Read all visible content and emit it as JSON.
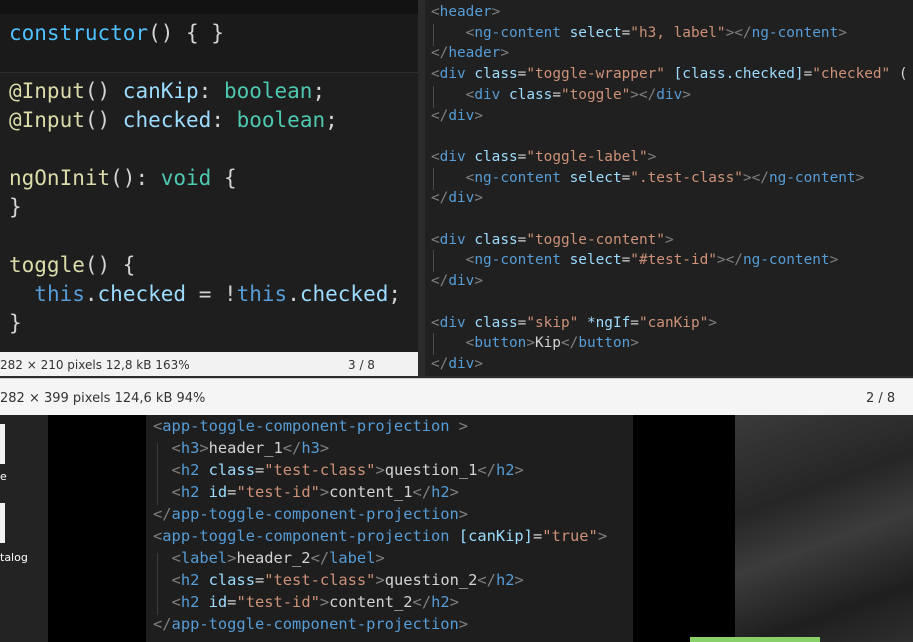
{
  "left_viewer": {
    "code_lines": [
      {
        "parts": [
          {
            "t": "constructor",
            "c": "kw-blue"
          },
          {
            "t": "() { }",
            "c": "plain"
          }
        ]
      },
      {
        "parts": []
      },
      {
        "parts": [
          {
            "t": "@Input",
            "c": "dec"
          },
          {
            "t": "() ",
            "c": "plain"
          },
          {
            "t": "canKip",
            "c": "attr"
          },
          {
            "t": ": ",
            "c": "plain"
          },
          {
            "t": "boolean",
            "c": "type"
          },
          {
            "t": ";",
            "c": "plain"
          }
        ]
      },
      {
        "parts": [
          {
            "t": "@Input",
            "c": "dec"
          },
          {
            "t": "() ",
            "c": "plain"
          },
          {
            "t": "checked",
            "c": "attr"
          },
          {
            "t": ": ",
            "c": "plain"
          },
          {
            "t": "boolean",
            "c": "type"
          },
          {
            "t": ";",
            "c": "plain"
          }
        ]
      },
      {
        "parts": []
      },
      {
        "parts": [
          {
            "t": "ngOnInit",
            "c": "fn"
          },
          {
            "t": "(): ",
            "c": "plain"
          },
          {
            "t": "void",
            "c": "type"
          },
          {
            "t": " {",
            "c": "plain"
          }
        ]
      },
      {
        "parts": [
          {
            "t": "}",
            "c": "plain"
          }
        ]
      },
      {
        "parts": []
      },
      {
        "parts": [
          {
            "t": "toggle",
            "c": "fn"
          },
          {
            "t": "() {",
            "c": "plain"
          }
        ]
      },
      {
        "parts": [
          {
            "t": "  ",
            "c": "plain"
          },
          {
            "t": "this",
            "c": "ctrl"
          },
          {
            "t": ".",
            "c": "plain"
          },
          {
            "t": "checked",
            "c": "attr"
          },
          {
            "t": " = !",
            "c": "plain"
          },
          {
            "t": "this",
            "c": "ctrl"
          },
          {
            "t": ".",
            "c": "plain"
          },
          {
            "t": "checked",
            "c": "attr"
          },
          {
            "t": ";",
            "c": "plain"
          }
        ]
      },
      {
        "parts": [
          {
            "t": "}",
            "c": "plain"
          }
        ]
      }
    ],
    "status_info": "282 × 210 pixels  12,8 kB   163%",
    "page_indicator": "3 / 8"
  },
  "right_viewer": {
    "code_lines": [
      {
        "parts": [
          {
            "t": "<",
            "c": "punc"
          },
          {
            "t": "header",
            "c": "tag"
          },
          {
            "t": ">",
            "c": "punc"
          }
        ]
      },
      {
        "parts": [
          {
            "t": "    <",
            "c": "punc"
          },
          {
            "t": "ng-content",
            "c": "tag"
          },
          {
            "t": " select",
            "c": "attr"
          },
          {
            "t": "=",
            "c": "plain"
          },
          {
            "t": "\"h3, label\"",
            "c": "str"
          },
          {
            "t": "></",
            "c": "punc"
          },
          {
            "t": "ng-content",
            "c": "tag"
          },
          {
            "t": ">",
            "c": "punc"
          }
        ]
      },
      {
        "parts": [
          {
            "t": "</",
            "c": "punc"
          },
          {
            "t": "header",
            "c": "tag"
          },
          {
            "t": ">",
            "c": "punc"
          }
        ]
      },
      {
        "parts": [
          {
            "t": "<",
            "c": "punc"
          },
          {
            "t": "div",
            "c": "tag"
          },
          {
            "t": " class",
            "c": "attr"
          },
          {
            "t": "=",
            "c": "plain"
          },
          {
            "t": "\"toggle-wrapper\"",
            "c": "str"
          },
          {
            "t": " [class.checked]",
            "c": "attr"
          },
          {
            "t": "=",
            "c": "plain"
          },
          {
            "t": "\"checked\"",
            "c": "str"
          },
          {
            "t": " (",
            "c": "plain"
          }
        ]
      },
      {
        "parts": [
          {
            "t": "    <",
            "c": "punc"
          },
          {
            "t": "div",
            "c": "tag"
          },
          {
            "t": " class",
            "c": "attr"
          },
          {
            "t": "=",
            "c": "plain"
          },
          {
            "t": "\"toggle\"",
            "c": "str"
          },
          {
            "t": "></",
            "c": "punc"
          },
          {
            "t": "div",
            "c": "tag"
          },
          {
            "t": ">",
            "c": "punc"
          }
        ]
      },
      {
        "parts": [
          {
            "t": "</",
            "c": "punc"
          },
          {
            "t": "div",
            "c": "tag"
          },
          {
            "t": ">",
            "c": "punc"
          }
        ]
      },
      {
        "parts": []
      },
      {
        "parts": [
          {
            "t": "<",
            "c": "punc"
          },
          {
            "t": "div",
            "c": "tag"
          },
          {
            "t": " class",
            "c": "attr"
          },
          {
            "t": "=",
            "c": "plain"
          },
          {
            "t": "\"toggle-label\"",
            "c": "str"
          },
          {
            "t": ">",
            "c": "punc"
          }
        ]
      },
      {
        "parts": [
          {
            "t": "    <",
            "c": "punc"
          },
          {
            "t": "ng-content",
            "c": "tag"
          },
          {
            "t": " select",
            "c": "attr"
          },
          {
            "t": "=",
            "c": "plain"
          },
          {
            "t": "\".test-class\"",
            "c": "str"
          },
          {
            "t": "></",
            "c": "punc"
          },
          {
            "t": "ng-content",
            "c": "tag"
          },
          {
            "t": ">",
            "c": "punc"
          }
        ]
      },
      {
        "parts": [
          {
            "t": "</",
            "c": "punc"
          },
          {
            "t": "div",
            "c": "tag"
          },
          {
            "t": ">",
            "c": "punc"
          }
        ]
      },
      {
        "parts": []
      },
      {
        "parts": [
          {
            "t": "<",
            "c": "punc"
          },
          {
            "t": "div",
            "c": "tag"
          },
          {
            "t": " class",
            "c": "attr"
          },
          {
            "t": "=",
            "c": "plain"
          },
          {
            "t": "\"toggle-content\"",
            "c": "str"
          },
          {
            "t": ">",
            "c": "punc"
          }
        ]
      },
      {
        "parts": [
          {
            "t": "    <",
            "c": "punc"
          },
          {
            "t": "ng-content",
            "c": "tag"
          },
          {
            "t": " select",
            "c": "attr"
          },
          {
            "t": "=",
            "c": "plain"
          },
          {
            "t": "\"#test-id\"",
            "c": "str"
          },
          {
            "t": "></",
            "c": "punc"
          },
          {
            "t": "ng-content",
            "c": "tag"
          },
          {
            "t": ">",
            "c": "punc"
          }
        ]
      },
      {
        "parts": [
          {
            "t": "</",
            "c": "punc"
          },
          {
            "t": "div",
            "c": "tag"
          },
          {
            "t": ">",
            "c": "punc"
          }
        ]
      },
      {
        "parts": []
      },
      {
        "parts": [
          {
            "t": "<",
            "c": "punc"
          },
          {
            "t": "div",
            "c": "tag"
          },
          {
            "t": " class",
            "c": "attr"
          },
          {
            "t": "=",
            "c": "plain"
          },
          {
            "t": "\"skip\"",
            "c": "str"
          },
          {
            "t": " *ngIf",
            "c": "attr"
          },
          {
            "t": "=",
            "c": "plain"
          },
          {
            "t": "\"canKip\"",
            "c": "str"
          },
          {
            "t": ">",
            "c": "punc"
          }
        ]
      },
      {
        "parts": [
          {
            "t": "    <",
            "c": "punc"
          },
          {
            "t": "button",
            "c": "tag"
          },
          {
            "t": ">",
            "c": "punc"
          },
          {
            "t": "Kip",
            "c": "plain"
          },
          {
            "t": "</",
            "c": "punc"
          },
          {
            "t": "button",
            "c": "tag"
          },
          {
            "t": ">",
            "c": "punc"
          }
        ]
      },
      {
        "parts": [
          {
            "t": "</",
            "c": "punc"
          },
          {
            "t": "div",
            "c": "tag"
          },
          {
            "t": ">",
            "c": "punc"
          }
        ]
      }
    ]
  },
  "bottom_viewer": {
    "status_info": "282 × 399 pixels  124,6 kB   94%",
    "page_indicator": "2 / 8",
    "desktop_labels": [
      "e",
      "talog"
    ],
    "code_lines": [
      {
        "parts": [
          {
            "t": "<",
            "c": "punc"
          },
          {
            "t": "app-toggle-component-projection",
            "c": "tag"
          },
          {
            "t": " >",
            "c": "punc"
          }
        ]
      },
      {
        "parts": [
          {
            "t": "  <",
            "c": "punc"
          },
          {
            "t": "h3",
            "c": "tag"
          },
          {
            "t": ">",
            "c": "punc"
          },
          {
            "t": "header_1",
            "c": "plain"
          },
          {
            "t": "</",
            "c": "punc"
          },
          {
            "t": "h3",
            "c": "tag"
          },
          {
            "t": ">",
            "c": "punc"
          }
        ]
      },
      {
        "parts": [
          {
            "t": "  <",
            "c": "punc"
          },
          {
            "t": "h2",
            "c": "tag"
          },
          {
            "t": " class",
            "c": "attr"
          },
          {
            "t": "=",
            "c": "plain"
          },
          {
            "t": "\"test-class\"",
            "c": "str"
          },
          {
            "t": ">",
            "c": "punc"
          },
          {
            "t": "question_1",
            "c": "plain"
          },
          {
            "t": "</",
            "c": "punc"
          },
          {
            "t": "h2",
            "c": "tag"
          },
          {
            "t": ">",
            "c": "punc"
          }
        ]
      },
      {
        "parts": [
          {
            "t": "  <",
            "c": "punc"
          },
          {
            "t": "h2",
            "c": "tag"
          },
          {
            "t": " id",
            "c": "attr"
          },
          {
            "t": "=",
            "c": "plain"
          },
          {
            "t": "\"test-id\"",
            "c": "str"
          },
          {
            "t": ">",
            "c": "punc"
          },
          {
            "t": "content_1",
            "c": "plain"
          },
          {
            "t": "</",
            "c": "punc"
          },
          {
            "t": "h2",
            "c": "tag"
          },
          {
            "t": ">",
            "c": "punc"
          }
        ]
      },
      {
        "parts": [
          {
            "t": "</",
            "c": "punc"
          },
          {
            "t": "app-toggle-component-projection",
            "c": "tag"
          },
          {
            "t": ">",
            "c": "punc"
          }
        ]
      },
      {
        "parts": [
          {
            "t": "<",
            "c": "punc"
          },
          {
            "t": "app-toggle-component-projection",
            "c": "tag"
          },
          {
            "t": " [canKip]",
            "c": "attr"
          },
          {
            "t": "=",
            "c": "plain"
          },
          {
            "t": "\"true\"",
            "c": "str"
          },
          {
            "t": ">",
            "c": "punc"
          }
        ]
      },
      {
        "parts": [
          {
            "t": "  <",
            "c": "punc"
          },
          {
            "t": "label",
            "c": "tag"
          },
          {
            "t": ">",
            "c": "punc"
          },
          {
            "t": "header_2",
            "c": "plain"
          },
          {
            "t": "</",
            "c": "punc"
          },
          {
            "t": "label",
            "c": "tag"
          },
          {
            "t": ">",
            "c": "punc"
          }
        ]
      },
      {
        "parts": [
          {
            "t": "  <",
            "c": "punc"
          },
          {
            "t": "h2",
            "c": "tag"
          },
          {
            "t": " class",
            "c": "attr"
          },
          {
            "t": "=",
            "c": "plain"
          },
          {
            "t": "\"test-class\"",
            "c": "str"
          },
          {
            "t": ">",
            "c": "punc"
          },
          {
            "t": "question_2",
            "c": "plain"
          },
          {
            "t": "</",
            "c": "punc"
          },
          {
            "t": "h2",
            "c": "tag"
          },
          {
            "t": ">",
            "c": "punc"
          }
        ]
      },
      {
        "parts": [
          {
            "t": "  <",
            "c": "punc"
          },
          {
            "t": "h2",
            "c": "tag"
          },
          {
            "t": " id",
            "c": "attr"
          },
          {
            "t": "=",
            "c": "plain"
          },
          {
            "t": "\"test-id\"",
            "c": "str"
          },
          {
            "t": ">",
            "c": "punc"
          },
          {
            "t": "content_2",
            "c": "plain"
          },
          {
            "t": "</",
            "c": "punc"
          },
          {
            "t": "h2",
            "c": "tag"
          },
          {
            "t": ">",
            "c": "punc"
          }
        ]
      },
      {
        "parts": [
          {
            "t": "</",
            "c": "punc"
          },
          {
            "t": "app-toggle-component-projection",
            "c": "tag"
          },
          {
            "t": ">",
            "c": "punc"
          }
        ]
      }
    ]
  }
}
